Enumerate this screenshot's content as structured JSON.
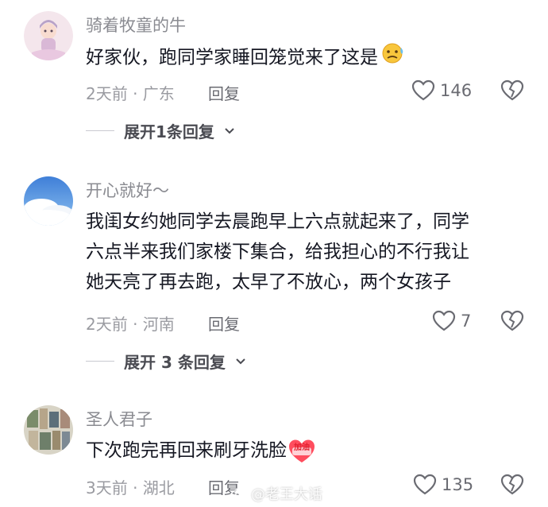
{
  "comments": [
    {
      "username": "骑着牧童的牛",
      "text": "好家伙，跑同学家睡回笼觉来了这是",
      "emoji": "nervous-sweat-emoji",
      "meta": "2天前 · 广东",
      "reply_label": "回复",
      "likes": "146",
      "expand_label": "展开1条回复"
    },
    {
      "username": "开心就好～",
      "text_lines": [
        "我闺女约她同学去晨跑早上六点就起来了，同学",
        "六点半来我们家楼下集合，给我担心的不行我让",
        "她天亮了再去跑，太早了不放心，两个女孩子"
      ],
      "meta": "2天前 · 河南",
      "reply_label": "回复",
      "likes": "7",
      "expand_label": "展开 3 条回复"
    },
    {
      "username": "圣人君子",
      "text": "下次跑完再回来刷牙洗脸",
      "emoji": "jiayou-sticker",
      "emoji_text": "加油",
      "meta": "3天前 · 湖北",
      "reply_label": "回复",
      "likes": "135"
    }
  ],
  "watermark": "@老王大话",
  "colors": {
    "text": "#161823",
    "secondary": "#8a8b91",
    "sticker": "#ff4d4f"
  }
}
